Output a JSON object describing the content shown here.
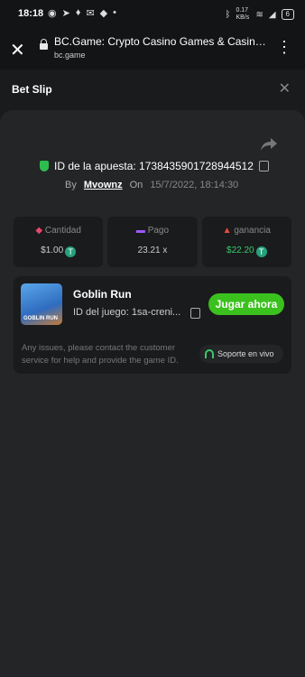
{
  "status": {
    "time": "18:18",
    "net_speed": "0.17 KB/s",
    "battery": "6"
  },
  "browser": {
    "title": "BC.Game: Crypto Casino Games & Casino Sl...",
    "url": "bc.game"
  },
  "header": {
    "title": "Bet Slip"
  },
  "bet": {
    "id_label": "ID de la apuesta: 1738435901728944512",
    "by_label": "By",
    "user": "Mvownz",
    "on_label": "On",
    "date": "15/7/2022, 18:14:30"
  },
  "stats": [
    {
      "label": "Cantidad",
      "value": "$1.00",
      "icon": "amount-icon",
      "color": "#e8476a"
    },
    {
      "label": "Pago",
      "value": "23.21 x",
      "icon": "payout-icon",
      "color": "#9b59ff"
    },
    {
      "label": "ganancia",
      "value": "$22.20",
      "icon": "profit-icon",
      "color": "#e84a3d"
    }
  ],
  "game": {
    "name": "Goblin Run",
    "id_text": "ID del juego: 1sa-creni...",
    "thumb_text": "GOBLIN RUN",
    "play_label": "Jugar ahora",
    "issues_text": "Any issues, please contact the customer service for help and provide the game ID.",
    "support_label": "Soporte en vivo"
  },
  "colors": {
    "accent": "#3bc11e",
    "profit": "#3bc96c",
    "tether": "#26a17b"
  }
}
